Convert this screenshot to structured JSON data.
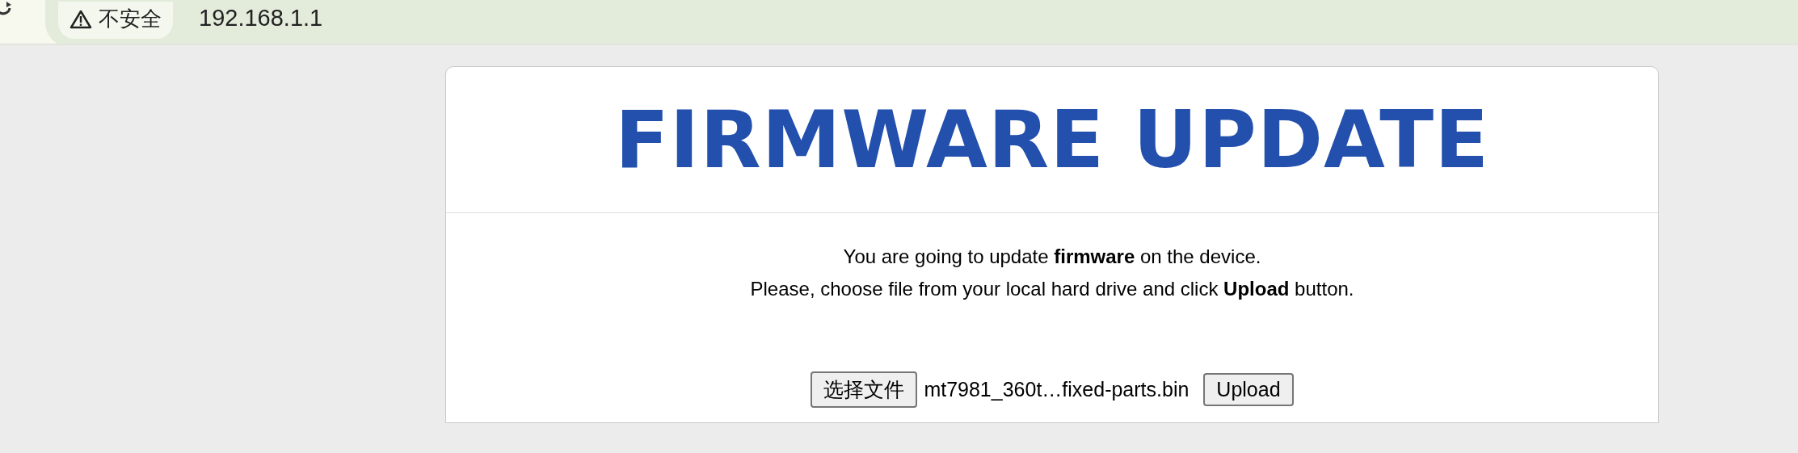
{
  "browser": {
    "security_label": "不安全",
    "address": "192.168.1.1"
  },
  "page": {
    "title": "FIRMWARE UPDATE",
    "lines": [
      "You are going to update **firmware** on the device.",
      "Please, choose file from your local hard drive and click **Upload** button."
    ],
    "file_button": "选择文件",
    "file_name": "mt7981_360t…fixed-parts.bin",
    "upload_button": "Upload"
  }
}
